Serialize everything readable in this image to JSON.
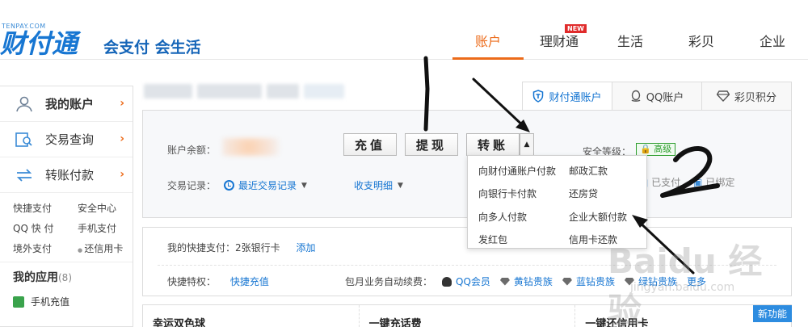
{
  "header": {
    "logo_tag": "TENPAY.COM",
    "logo_main": "财付通",
    "slogan": "会支付 会生活",
    "nav": [
      {
        "label": "账户"
      },
      {
        "label": "理财通",
        "badge": "NEW"
      },
      {
        "label": "生活"
      },
      {
        "label": "彩贝"
      },
      {
        "label": "企业"
      }
    ]
  },
  "sidebar": {
    "items": [
      {
        "label": "我的账户"
      },
      {
        "label": "交易查询"
      },
      {
        "label": "转账付款"
      }
    ],
    "links": [
      "快捷支付",
      "安全中心",
      "QQ 快 付",
      "手机支付",
      "境外支付",
      "还信用卡"
    ],
    "apps_title": "我的应用",
    "apps_count": "(8)",
    "apps": [
      "手机充值"
    ]
  },
  "account_tabs": [
    "财付通账户",
    "QQ账户",
    "彩贝积分"
  ],
  "account": {
    "balance_label": "账户余额：",
    "buttons": {
      "recharge": "充值",
      "withdraw": "提现",
      "transfer": "转账"
    },
    "records_label": "交易记录：",
    "recent_records": "最近交易记录",
    "income_detail": "收支明细",
    "security_label": "安全等级：",
    "security_level": "高级",
    "bind_phone": "已支付",
    "bind_other": "已绑定"
  },
  "dropdown": [
    "向财付通账户付款",
    "邮政汇款",
    "向银行卡付款",
    "还房贷",
    "向多人付款",
    "企业大额付款",
    "发红包",
    "信用卡还款"
  ],
  "quick_pay": {
    "label": "我的快捷支付：2张银行卡",
    "add": "添加",
    "privilege_label": "快捷特权：",
    "privilege_link": "快捷充值",
    "autorenew_label": "包月业务自动续费：",
    "autorenew_items": [
      "QQ会员",
      "黄钻贵族",
      "蓝钻贵族",
      "绿钻贵族",
      "更多"
    ]
  },
  "cards": [
    "幸运双色球",
    "一键充话费",
    "一键还信用卡"
  ],
  "new_feature": "新功能",
  "annotations": {
    "mark_1": "1",
    "mark_2": "2"
  },
  "watermark": {
    "text": "Baidu 经验",
    "url": "jingyan.baidu.com"
  },
  "colors": {
    "accent": "#ec6b1a",
    "link": "#1776d2",
    "secure": "#2b9d2b"
  }
}
